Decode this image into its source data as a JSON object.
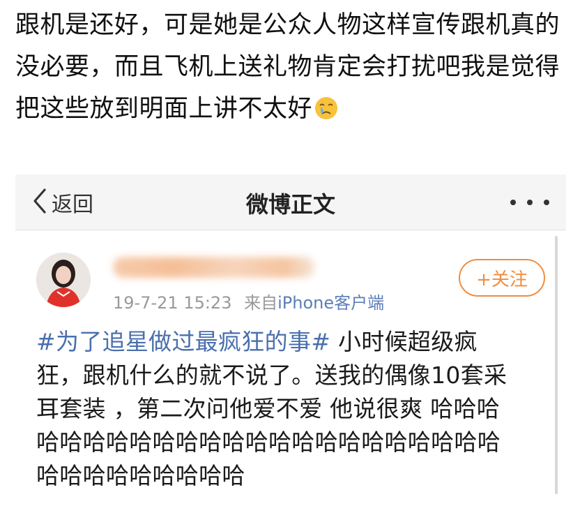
{
  "comment": {
    "lines": [
      "跟机是还好，可是她是公众人物这样宣传跟机真的",
      "没必要，而且飞机上送礼物肯定会打扰吧我是觉得",
      "把这些放到明面上讲不太好"
    ],
    "emoji": "crying-face-icon"
  },
  "nav": {
    "back_label": "返回",
    "title": "微博正文"
  },
  "post": {
    "username": "██████████",
    "timestamp": "19-7-21 15:23",
    "source_label": "来自",
    "source_device": "iPhone客户端",
    "follow_label": "+关注",
    "hashtag": "#为了追星做过最疯狂的事#",
    "lines": [
      "小时候超级疯",
      "狂，跟机什么的就不说了。送我的偶像10套采",
      "耳套装 ，第二次问他爱不爱 他说很爽 哈哈哈",
      "哈哈哈哈哈哈哈哈哈哈哈哈哈哈哈哈哈哈哈哈",
      "哈哈哈哈哈哈哈哈哈"
    ]
  },
  "colors": {
    "hashtag": "#4a6fad",
    "follow_accent": "#f08d3e",
    "nav_background": "#f5f5f5",
    "meta_gray": "#999999"
  }
}
